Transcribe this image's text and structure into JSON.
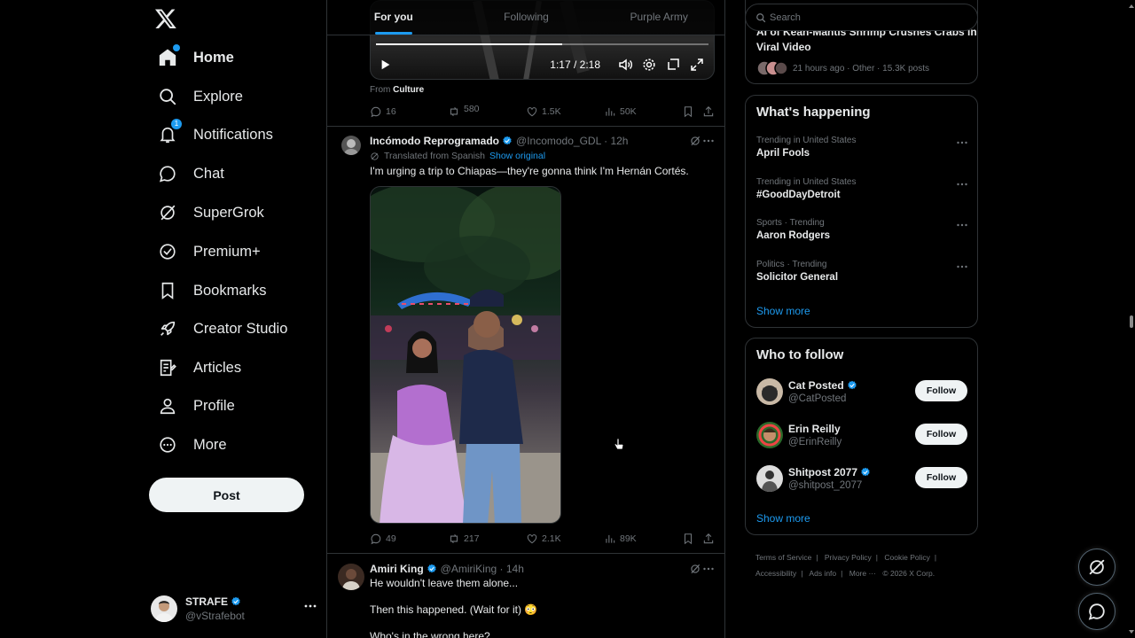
{
  "sidebar": {
    "nav": [
      {
        "label": "Home",
        "icon": "home-icon"
      },
      {
        "label": "Explore",
        "icon": "search-icon"
      },
      {
        "label": "Notifications",
        "icon": "bell-icon",
        "badge": "1"
      },
      {
        "label": "Chat",
        "icon": "chat-icon"
      },
      {
        "label": "SuperGrok",
        "icon": "grok-icon"
      },
      {
        "label": "Premium+",
        "icon": "premium-icon"
      },
      {
        "label": "Bookmarks",
        "icon": "bookmark-icon"
      },
      {
        "label": "Creator Studio",
        "icon": "rocket-icon"
      },
      {
        "label": "Articles",
        "icon": "articles-icon"
      },
      {
        "label": "Profile",
        "icon": "person-icon"
      },
      {
        "label": "More",
        "icon": "more-circle-icon"
      }
    ],
    "post_label": "Post",
    "account": {
      "name": "STRAFE",
      "handle": "@vStrafebot"
    }
  },
  "feed": {
    "tabs": [
      "For you",
      "Following",
      "Purple Army"
    ],
    "video": {
      "time": "1:17 / 2:18",
      "progress": 0.56
    },
    "from_prefix": "From",
    "from_community": "Culture",
    "tweet0_actions": {
      "replies": "16",
      "reposts": "580",
      "likes": "1.5K",
      "views": "50K"
    },
    "tweet1": {
      "name": "Incómodo Reprogramado",
      "handle": "@Incomodo_GDL · 12h",
      "translated": "Translated from Spanish",
      "show_original": "Show original",
      "text": "I'm urging a trip to Chiapas—they're gonna think I'm Hernán Cortés.",
      "actions": {
        "replies": "49",
        "reposts": "217",
        "likes": "2.1K",
        "views": "89K"
      }
    },
    "tweet2": {
      "name": "Amiri King",
      "handle": "@AmiriKing · 14h",
      "line1": "He wouldn't leave them alone...",
      "line2": "Then this happened. (Wait for it) 😳",
      "line3": "Who's in the wrong here?"
    }
  },
  "right": {
    "search_placeholder": "Search",
    "news": {
      "title": "AI of Kean-Mantis Shrimp Crushes Crabs in Viral Video",
      "title_line1": "AI of Kean-Mantis Shrimp Crushes Crabs in",
      "title_line2": "Viral Video",
      "meta": "21 hours ago · Other · 15.3K posts"
    },
    "whats_happening": {
      "title": "What's happening",
      "trends": [
        {
          "meta": "Trending in United States",
          "name": "April Fools"
        },
        {
          "meta": "Trending in United States",
          "name": "#GoodDayDetroit"
        },
        {
          "meta": "Sports · Trending",
          "name": "Aaron Rodgers"
        },
        {
          "meta": "Politics · Trending",
          "name": "Solicitor General"
        }
      ],
      "show_more": "Show more"
    },
    "who_to_follow": {
      "title": "Who to follow",
      "users": [
        {
          "name": "Cat Posted",
          "handle": "@CatPosted",
          "verified": true
        },
        {
          "name": "Erin Reilly",
          "handle": "@ErinReilly",
          "verified": false
        },
        {
          "name": "Shitpost 2077",
          "handle": "@shitpost_2077",
          "verified": true
        }
      ],
      "follow_label": "Follow",
      "show_more": "Show more"
    },
    "footer": {
      "links": [
        "Terms of Service",
        "Privacy Policy",
        "Cookie Policy",
        "Accessibility",
        "Ads info",
        "More ···"
      ],
      "copyright": "© 2026 X Corp."
    }
  },
  "colors": {
    "accent": "#1d9bf0",
    "background": "#000000",
    "border": "#2f3336",
    "muted": "#71767b",
    "text": "#e7e9ea"
  }
}
